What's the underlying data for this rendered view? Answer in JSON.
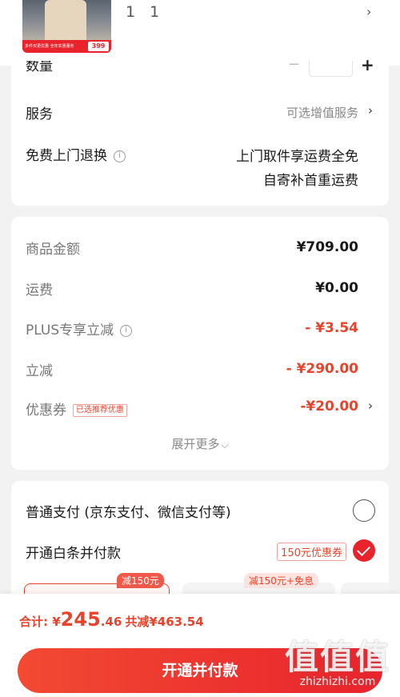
{
  "product": {
    "name": "1 1",
    "thumb_promo_text": "多件买更优惠 全年实惠服务",
    "thumb_price": "399"
  },
  "order": {
    "quantity_label": "数量",
    "service_label": "服务",
    "service_value": "可选增值服务",
    "return_label": "免费上门退换",
    "return_line1": "上门取件享运费全免",
    "return_line2": "自寄补首重运费"
  },
  "price": {
    "rows": [
      {
        "label": "商品金额",
        "value": "¥709.00"
      },
      {
        "label": "运费",
        "value": "¥0.00"
      },
      {
        "label": "PLUS专享立减",
        "value": "- ¥3.54"
      },
      {
        "label": "立减",
        "value": "- ¥290.00"
      },
      {
        "label": "优惠券",
        "value": "-¥20.00",
        "tag": "已选推荐优惠"
      }
    ],
    "expand_more": "展开更多"
  },
  "payment": {
    "normal_label": "普通支付 (京东支付、微信支付等)",
    "baitiao_label": "开通白条并付款",
    "baitiao_coupon": "150元优惠券",
    "plan1_tag": "减150元",
    "plan2_tag": "减150元+免息"
  },
  "checkout": {
    "total_label": "合计: ",
    "currency": "¥",
    "total_int": "245",
    "total_dec": ".46",
    "save_text": "共减¥463.54",
    "pay_button": "开通并付款"
  },
  "watermark": {
    "big": "值值值",
    "small": "zhizhizhi.com"
  },
  "colors": {
    "accent": "#e8232c",
    "price_red": "#e8432c"
  }
}
